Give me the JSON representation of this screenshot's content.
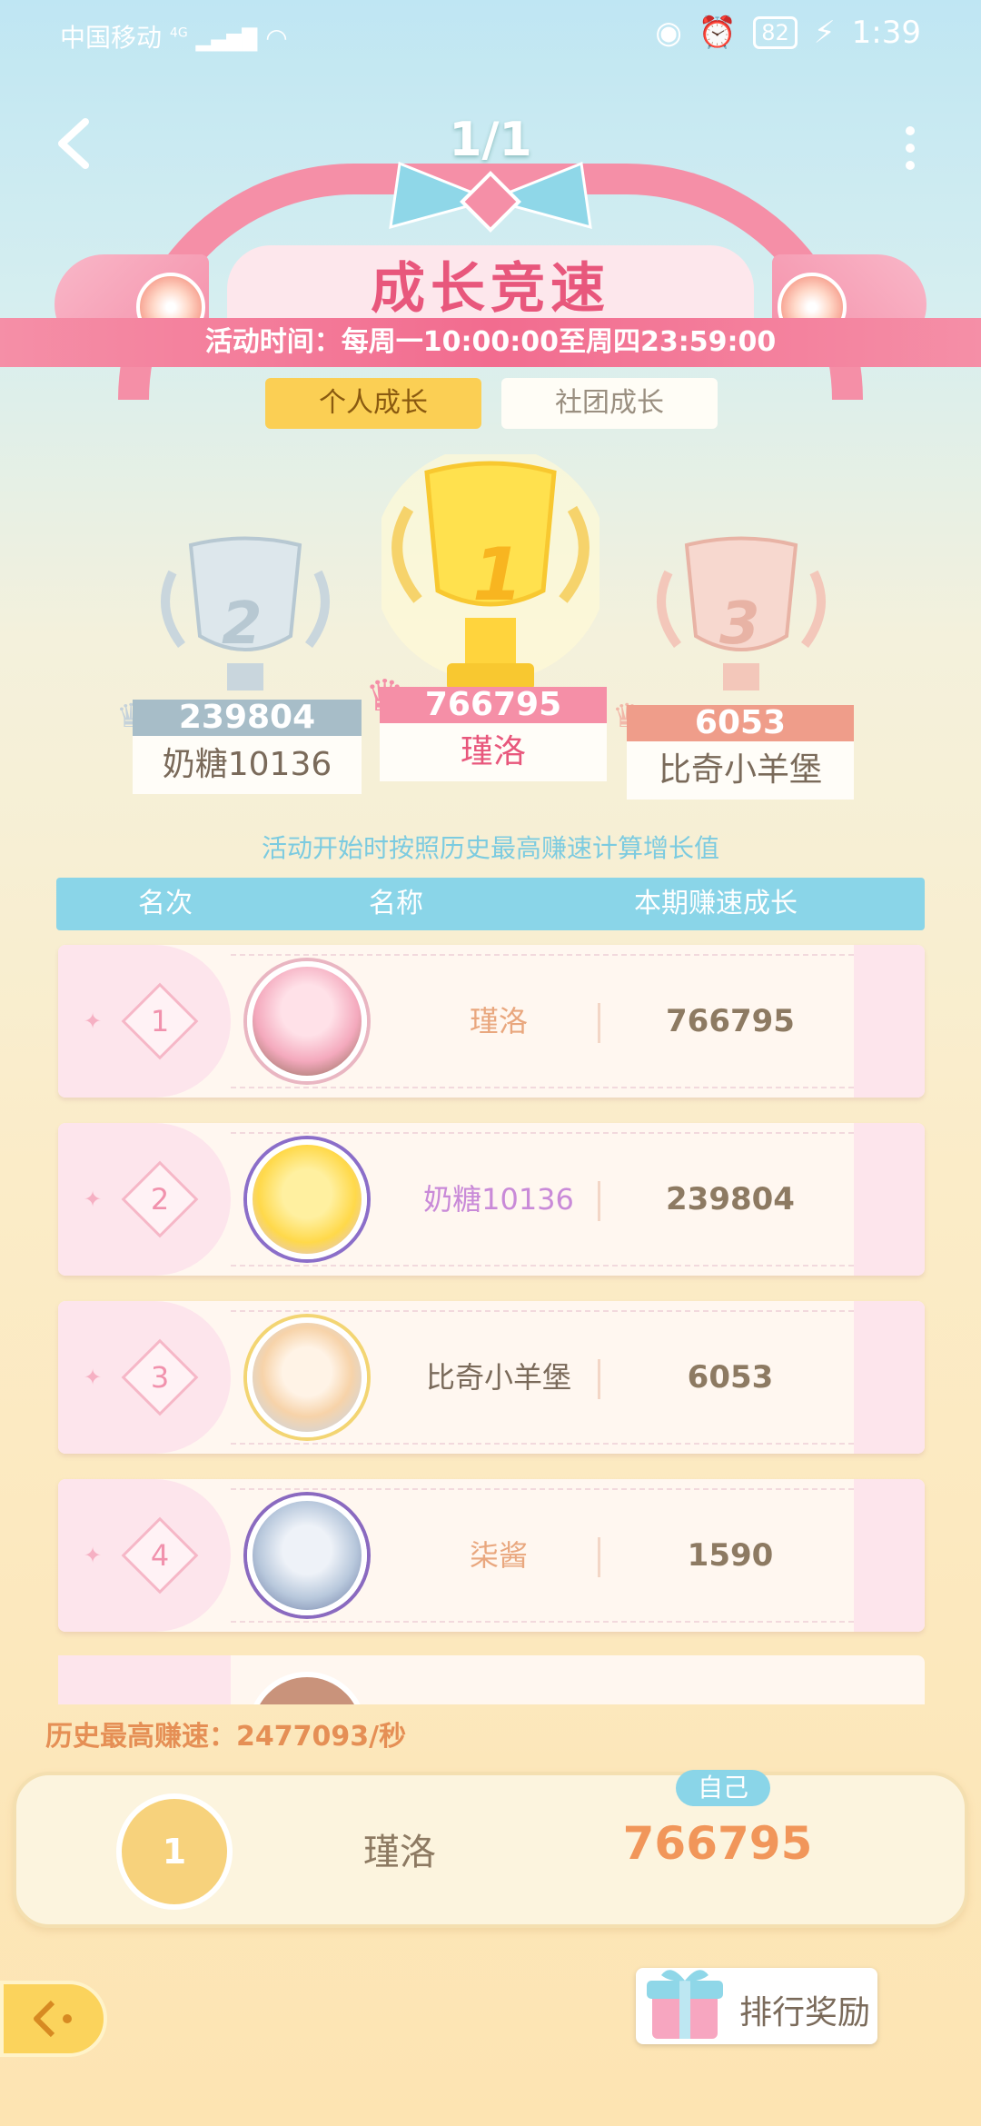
{
  "status_bar": {
    "carrier": "中国移动",
    "signal": "4G",
    "battery": "82",
    "time": "1:39"
  },
  "header": {
    "title": "1/1",
    "banner_title": "成长竞速",
    "time_text": "活动时间：每周一10:00:00至周四23:59:00"
  },
  "tabs": [
    {
      "label": "个人成长",
      "active": true
    },
    {
      "label": "社团成长",
      "active": false
    }
  ],
  "podium": [
    {
      "rank": "2",
      "score": "239804",
      "name": "奶糖10136"
    },
    {
      "rank": "1",
      "score": "766795",
      "name": "瑾洛"
    },
    {
      "rank": "3",
      "score": "6053",
      "name": "比奇小羊堡"
    }
  ],
  "note": "活动开始时按照历史最高赚速计算增长值",
  "table": {
    "headers": {
      "rank": "名次",
      "name": "名称",
      "growth": "本期赚速成长"
    },
    "rows": [
      {
        "rank": "1",
        "name": "瑾洛",
        "score": "766795"
      },
      {
        "rank": "2",
        "name": "奶糖10136",
        "score": "239804"
      },
      {
        "rank": "3",
        "name": "比奇小羊堡",
        "score": "6053"
      },
      {
        "rank": "4",
        "name": "柒酱",
        "score": "1590"
      }
    ]
  },
  "history_best": "历史最高赚速：2477093/秒",
  "self": {
    "badge": "自己",
    "rank": "1",
    "name": "瑾洛",
    "score": "766795"
  },
  "reward_button": "排行奖励",
  "icons": [
    "back-icon",
    "more-icon",
    "wifi-icon",
    "eye-icon",
    "alarm-icon",
    "charging-icon",
    "trophy-icon",
    "crown-icon",
    "gift-icon",
    "back-arrow-icon"
  ],
  "colors": {
    "accent_pink": "#f26c8f",
    "accent_yellow": "#fbcf54",
    "table_header": "#8ad5e8",
    "score_orange": "#f1965a"
  }
}
